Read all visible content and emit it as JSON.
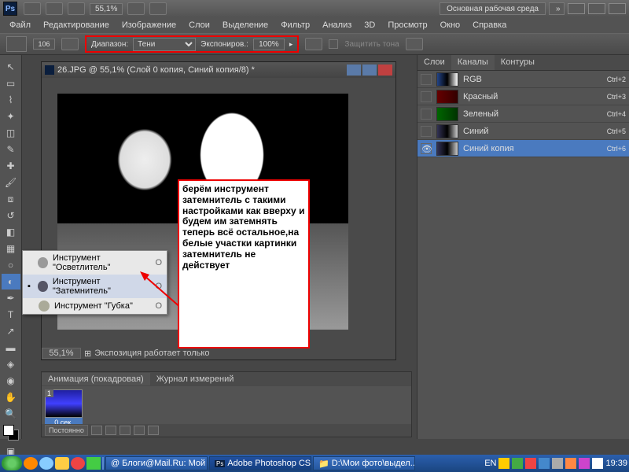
{
  "titlebar": {
    "zoom": "55,1%",
    "workspace": "Основная рабочая среда"
  },
  "menu": [
    "Файл",
    "Редактирование",
    "Изображение",
    "Слои",
    "Выделение",
    "Фильтр",
    "Анализ",
    "3D",
    "Просмотр",
    "Окно",
    "Справка"
  ],
  "optbar": {
    "brush": "106",
    "range_label": "Диапазон:",
    "range_value": "Тени",
    "exposure_label": "Экспониров.:",
    "exposure_value": "100%",
    "protect": "Защитить тона"
  },
  "doc": {
    "title": "26.JPG @ 55,1% (Слой 0 копия, Синий копия/8) *",
    "zoom": "55,1%",
    "footer": "Экспозиция работает только"
  },
  "tool_popup": [
    {
      "label": "Инструмент \"Осветлитель\"",
      "key": "O"
    },
    {
      "label": "Инструмент \"Затемнитель\"",
      "key": "O",
      "sel": true
    },
    {
      "label": "Инструмент \"Губка\"",
      "key": "O"
    }
  ],
  "annotation": "берём инструмент затемнитель с такими настройками как вверху и будем им затемнять теперь всё остальное,на белые участки картинки затемнитель не действует",
  "right_tabs": [
    "Слои",
    "Каналы",
    "Контуры"
  ],
  "channels": [
    {
      "name": "RGB",
      "key": "Ctrl+2",
      "cls": "rgb"
    },
    {
      "name": "Красный",
      "key": "Ctrl+3",
      "cls": "r"
    },
    {
      "name": "Зеленый",
      "key": "Ctrl+4",
      "cls": "g"
    },
    {
      "name": "Синий",
      "key": "Ctrl+5",
      "cls": "b"
    },
    {
      "name": "Синий копия",
      "key": "Ctrl+6",
      "cls": "b2",
      "sel": true,
      "eye": true
    }
  ],
  "anim": {
    "tabs": [
      "Анимация (покадровая)",
      "Журнал измерений"
    ],
    "frame_time": "0 сек.",
    "loop": "Постоянно"
  },
  "taskbar": {
    "items": [
      "Блоги@Mail.Ru: Мой ...",
      "Adobe Photoshop CS...",
      "D:\\Мои фото\\выдел..."
    ],
    "lang": "EN",
    "time": "19:39"
  }
}
